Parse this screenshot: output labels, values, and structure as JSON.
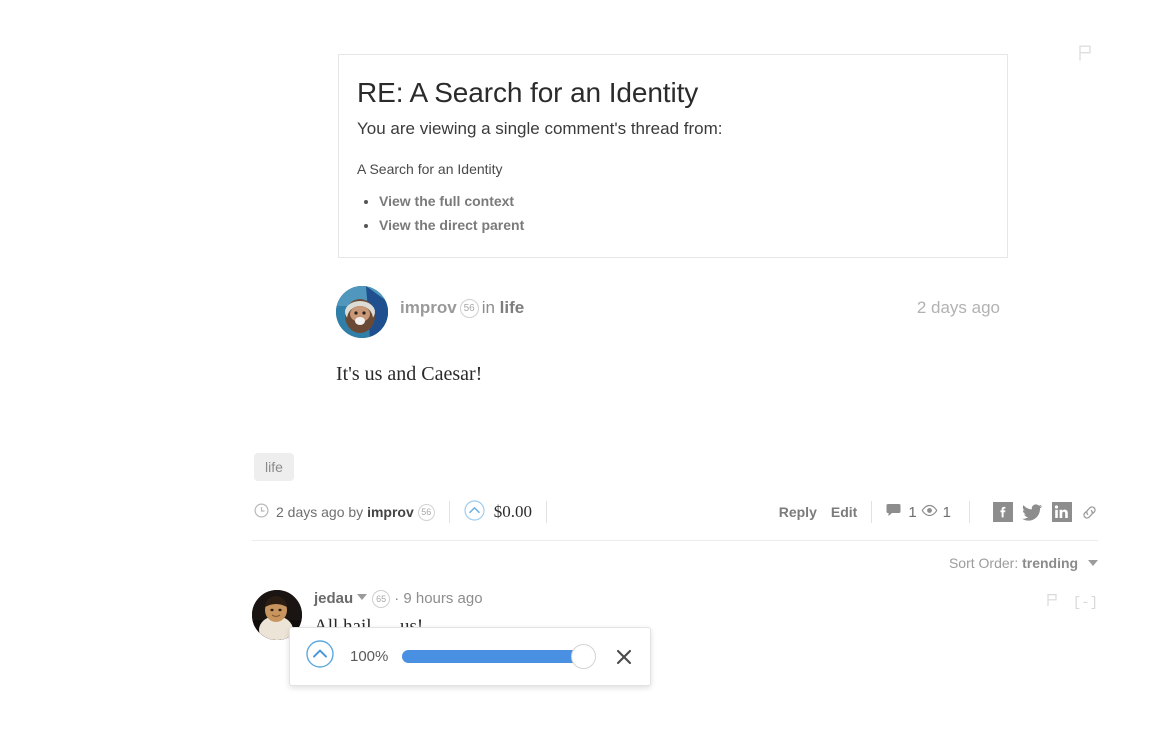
{
  "card": {
    "title": "RE: A Search for an Identity",
    "subtitle": "You are viewing a single comment's thread from:",
    "parent_post": "A Search for an Identity",
    "links": [
      {
        "label": "View the full context"
      },
      {
        "label": "View the direct parent"
      }
    ]
  },
  "author": {
    "name": "improv",
    "reputation": "56",
    "in_word": "in",
    "community": "life",
    "timestamp": "2 days ago"
  },
  "post": {
    "body": "It's us and Caesar!",
    "tag": "life"
  },
  "action_bar": {
    "age_by": "2 days ago by",
    "author": "improv",
    "reputation": "56",
    "payout": "$0.00",
    "reply_label": "Reply",
    "edit_label": "Edit",
    "comment_count": "1",
    "view_count": "1",
    "share": [
      "facebook-icon",
      "twitter-icon",
      "linkedin-icon",
      "link-icon"
    ]
  },
  "sort": {
    "label": "Sort Order:",
    "value": "trending"
  },
  "reply": {
    "name": "jedau",
    "reputation": "65",
    "separator": "·",
    "timestamp": "9 hours ago",
    "body": "All hail — us!",
    "collapse": "[-]"
  },
  "vote_popup": {
    "percent": "100%",
    "fill_ratio": 1.0,
    "upvote_icon": "upvote-circle-icon",
    "close_icon": "close-icon"
  },
  "colors": {
    "accent_blue": "#4a90e2",
    "upvote_outline": "#7cb9e8",
    "muted_text": "#9a9a9a",
    "card_border": "#e6e6e6"
  }
}
